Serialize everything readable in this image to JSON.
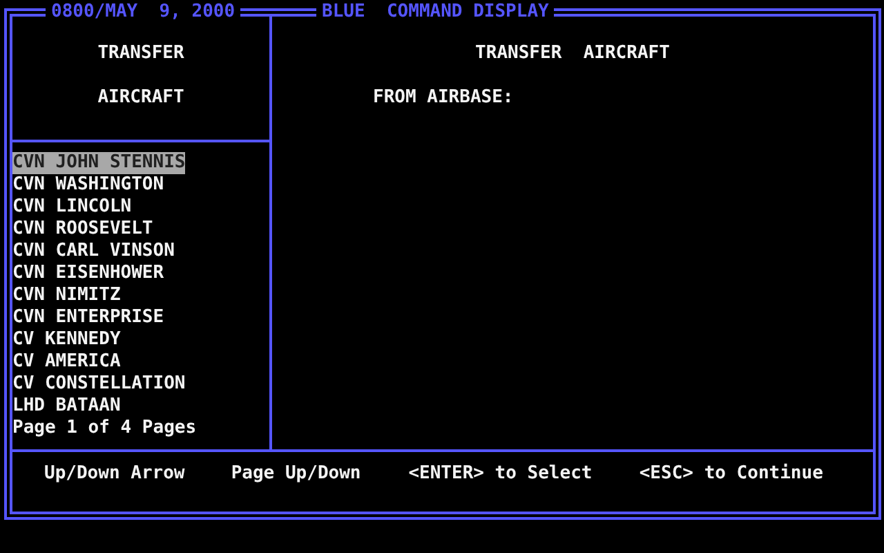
{
  "header": {
    "datetime": "0800/MAY  9, 2000",
    "title": "BLUE  COMMAND DISPLAY"
  },
  "left_panel": {
    "heading_lines": [
      "TRANSFER",
      "AIRCRAFT"
    ],
    "items": [
      {
        "label": "CVN JOHN STENNIS",
        "selected": true
      },
      {
        "label": "CVN WASHINGTON",
        "selected": false
      },
      {
        "label": "CVN LINCOLN",
        "selected": false
      },
      {
        "label": "CVN ROOSEVELT",
        "selected": false
      },
      {
        "label": "CVN CARL VINSON",
        "selected": false
      },
      {
        "label": "CVN EISENHOWER",
        "selected": false
      },
      {
        "label": "CVN NIMITZ",
        "selected": false
      },
      {
        "label": "CVN ENTERPRISE",
        "selected": false
      },
      {
        "label": "CV KENNEDY",
        "selected": false
      },
      {
        "label": "CV AMERICA",
        "selected": false
      },
      {
        "label": "CV CONSTELLATION",
        "selected": false
      },
      {
        "label": "LHD BATAAN",
        "selected": false
      }
    ],
    "page_info": "Page 1 of 4 Pages"
  },
  "right_panel": {
    "title": "TRANSFER  AIRCRAFT",
    "prompt": "FROM AIRBASE:"
  },
  "key_hints": [
    "Up/Down Arrow",
    "Page Up/Down",
    "<ENTER> to Select",
    "<ESC> to Continue"
  ]
}
